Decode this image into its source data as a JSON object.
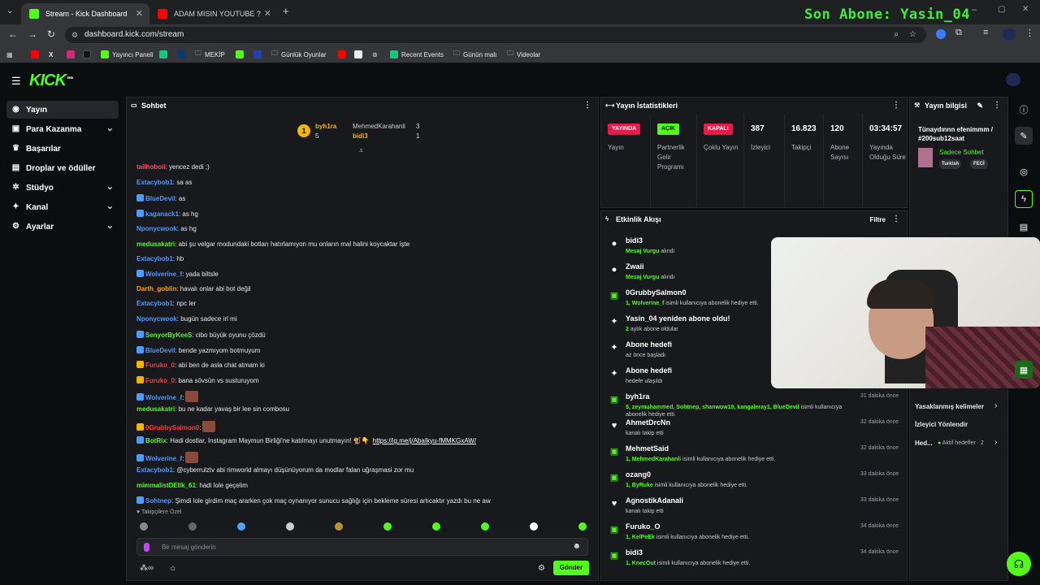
{
  "browser": {
    "tabs": [
      {
        "title": "Stream - Kick Dashboard"
      },
      {
        "title": "ADAM MISIN YOUTUBE ? | Rude"
      }
    ],
    "url": "dashboard.kick.com/stream",
    "bookmarks": [
      "Yayıncı Paneli",
      "MEKİP",
      "Günlük Oyunlar",
      "Recent Events",
      "Günün malı",
      "Videolar"
    ]
  },
  "overlay": {
    "text": "Son Abone: Yasin_04"
  },
  "kick": {
    "logo": "KICK",
    "beta": "BETA"
  },
  "nav": [
    {
      "label": "Yayın"
    },
    {
      "label": "Para Kazanma"
    },
    {
      "label": "Başarılar"
    },
    {
      "label": "Droplar ve ödüller"
    },
    {
      "label": "Stüdyo"
    },
    {
      "label": "Kanal"
    },
    {
      "label": "Ayarlar"
    }
  ],
  "chat": {
    "title": "Sohbet",
    "leaderboard": {
      "rank": "1",
      "first": "byh1ra",
      "first_count": "5",
      "second": "MehmedKarahanli",
      "second_count": "3",
      "third": "bidi3",
      "third_count": "1"
    },
    "messages": [
      {
        "user": "tailhoboii",
        "text": ": yencez dedi ;)",
        "color": "#ff4d6d"
      },
      {
        "user": "Extacybob1",
        "text": ": sa as",
        "color": "#4d9bff"
      },
      {
        "user": "BlueDevil",
        "text": ": as",
        "color": "#4d9bff"
      },
      {
        "user": "kaganack1",
        "text": ": as hg",
        "color": "#4d9bff"
      },
      {
        "user": "Nponycwook",
        "text": ": as hg",
        "color": "#4d9bff"
      },
      {
        "user": "medusakatri",
        "text": ": abi şu velgar modundaki botları hatırlamıyon mu onların mal halini koycaktar işte",
        "color": "#53fc18"
      },
      {
        "user": "Extacybob1",
        "text": ": hb",
        "color": "#4d9bff"
      },
      {
        "user": "Wolverine_f",
        "text": ": yada biltsle",
        "color": "#4d9bff"
      },
      {
        "user": "Darth_goblin",
        "text": ": havalı onlar abi bot değil",
        "color": "#ff9f1a"
      },
      {
        "user": "Extacybob1",
        "text": ": npc ler",
        "color": "#4d9bff"
      },
      {
        "user": "Nponycwook",
        "text": ": bugün sadece irl mi",
        "color": "#4d9bff"
      },
      {
        "user": "SenyorByKeeS",
        "text": ": cibo büyük oyunu çözdü",
        "color": "#53fc18"
      },
      {
        "user": "BlueDevil",
        "text": ": bende yazmıyom botmuyum",
        "color": "#4d9bff"
      },
      {
        "user": "Furuko_0",
        "text": ": abi ben de asla chat atmam ki",
        "color": "#ff3b3b"
      },
      {
        "user": "Furuko_0",
        "text": ": bana sövsün vs susturuyom",
        "color": "#ff3b3b"
      },
      {
        "user": "Wolverine_f",
        "text": ":",
        "color": "#4d9bff"
      },
      {
        "user": "medusakatri",
        "text": ": bu ne kadar yavaş bir lee sin combosu",
        "color": "#53fc18"
      },
      {
        "user": "0GrubbySalmon0",
        "text": ":",
        "color": "#ff3b3b"
      },
      {
        "user": "BotRix",
        "text": ": Hadi dostlar, Instagram Maymun Birliği'ne katılmayı unutmayın! 🐒👇",
        "link": "https://ig.me/j/AbaIkyu-fMMKGxAW/",
        "color": "#53fc18"
      },
      {
        "user": "Wolverine_f",
        "text": ":",
        "color": "#4d9bff"
      },
      {
        "user": "Extacybob1",
        "text": ": @cyberrulztv abi rimworld almayı düşünüyorum da modlar falan uğraşmasi zor mu",
        "color": "#4d9bff"
      },
      {
        "user": "mimmalistDEIlk_61",
        "text": ": hadi lole geçelim",
        "color": "#53fc18"
      },
      {
        "user": "Sohtnep",
        "text": ": Şimdi lole girdim maç ararken çok maç oynanıyor sunucu sağlığı için bekleme süresi artıcaktır yazdı bu ne aw",
        "color": "#4d9bff"
      }
    ],
    "followers_only": "Takipçilere Özel",
    "input_placeholder": "Bir mesaj gönderin",
    "send": "Gönder"
  },
  "stats": {
    "title": "Yayın İstatistikleri",
    "items": [
      {
        "value": "YAYINDA",
        "label": "Yayın",
        "kind": "pill",
        "bg": "#e91948",
        "fg": "#ffffff"
      },
      {
        "value": "AÇIK",
        "label": "Partnerlik Gelir Programı",
        "kind": "pill",
        "bg": "#53fc18",
        "fg": "#0b0e0f"
      },
      {
        "value": "KAPALI",
        "label": "Çoklu Yayın",
        "kind": "pill",
        "bg": "#e91948",
        "fg": "#ffffff"
      },
      {
        "value": "387",
        "label": "İzleyici",
        "kind": "num"
      },
      {
        "value": "16.823",
        "label": "Takipçi",
        "kind": "num"
      },
      {
        "value": "120",
        "label": "Abone Sayısı",
        "kind": "num"
      },
      {
        "value": "03:34:57",
        "label": "Yayında Olduğu Süre",
        "kind": "num"
      }
    ]
  },
  "activity": {
    "title": "Etkinlik Akışı",
    "filter": "Filtre",
    "items": [
      {
        "icon": "chat",
        "name": "bidi3",
        "desc_hl": "Mesaj Vurgu",
        "desc": " alındı",
        "time": ""
      },
      {
        "icon": "chat",
        "name": "Zwaii",
        "desc_hl": "Mesaj Vurgu",
        "desc": " alındı",
        "time": ""
      },
      {
        "icon": "gift",
        "name": "0GrubbySalmon0",
        "desc_hl": "1, Wolverine_f",
        "desc": " isimli kullanıcıya abonelik hediye etti.",
        "time": ""
      },
      {
        "icon": "star",
        "name": "Yasin_04 yeniden abone oldu!",
        "desc_hl": "2",
        "desc": " aylık abone oldular",
        "time": ""
      },
      {
        "icon": "star",
        "name": "Abone hedefi",
        "desc_hl": "",
        "desc": "az önce başladı",
        "time": ""
      },
      {
        "icon": "star",
        "name": "Abone hedefi",
        "desc_hl": "",
        "desc": "hedefe ulaşıldı",
        "time": ""
      },
      {
        "icon": "gift",
        "name": "byh1ra",
        "desc_hl": "5, zeymuhammed, Sohtnep, shanwow10, kangaleray1, BlueDevil",
        "desc": " isimli kullanıcıya abonelik hediye etti.",
        "time": "31 dakika önce"
      },
      {
        "icon": "heart",
        "name": "AhmetDrcNn",
        "desc_hl": "",
        "desc": "kanalı takip etti",
        "time": "32 dakika önce"
      },
      {
        "icon": "gift",
        "name": "MehmetSaid",
        "desc_hl": "1, MehmedKarahanli",
        "desc": " isimli kullanıcıya abonelik hediye etti.",
        "time": "32 dakika önce"
      },
      {
        "icon": "gift",
        "name": "ozang0",
        "desc_hl": "1, ByRuke",
        "desc": " isimli kullanıcıya abonelik hediye etti.",
        "time": "33 dakika önce"
      },
      {
        "icon": "heart",
        "name": "AgnostikAdanali",
        "desc_hl": "",
        "desc": "kanalı takip etti",
        "time": "33 dakika önce"
      },
      {
        "icon": "gift",
        "name": "Furuko_O",
        "desc_hl": "1, KelPeEk",
        "desc": " isimli kullanıcıya abonelik hediye etti.",
        "time": "34 dakika önce"
      },
      {
        "icon": "gift",
        "name": "bidi3",
        "desc_hl": "1, KnecOut",
        "desc": " isimli kullanıcıya abonelik hediye etti.",
        "time": "34 dakika önce"
      }
    ]
  },
  "info": {
    "title": "Yayın bilgisi",
    "stream_title": "Tünaydınnn efenimmm / #200sub12saat",
    "category": "Sadece Sohbet",
    "tags": [
      "Turkish",
      "FECİ"
    ],
    "banned_words": "Yasaklanmış kelimeler",
    "redirect": "İzleyici Yönlendir",
    "goals": "Hed...",
    "goals_active": "Aktif hedefler · 2"
  },
  "colors": {
    "accent": "#53fc18",
    "live": "#e91948"
  }
}
